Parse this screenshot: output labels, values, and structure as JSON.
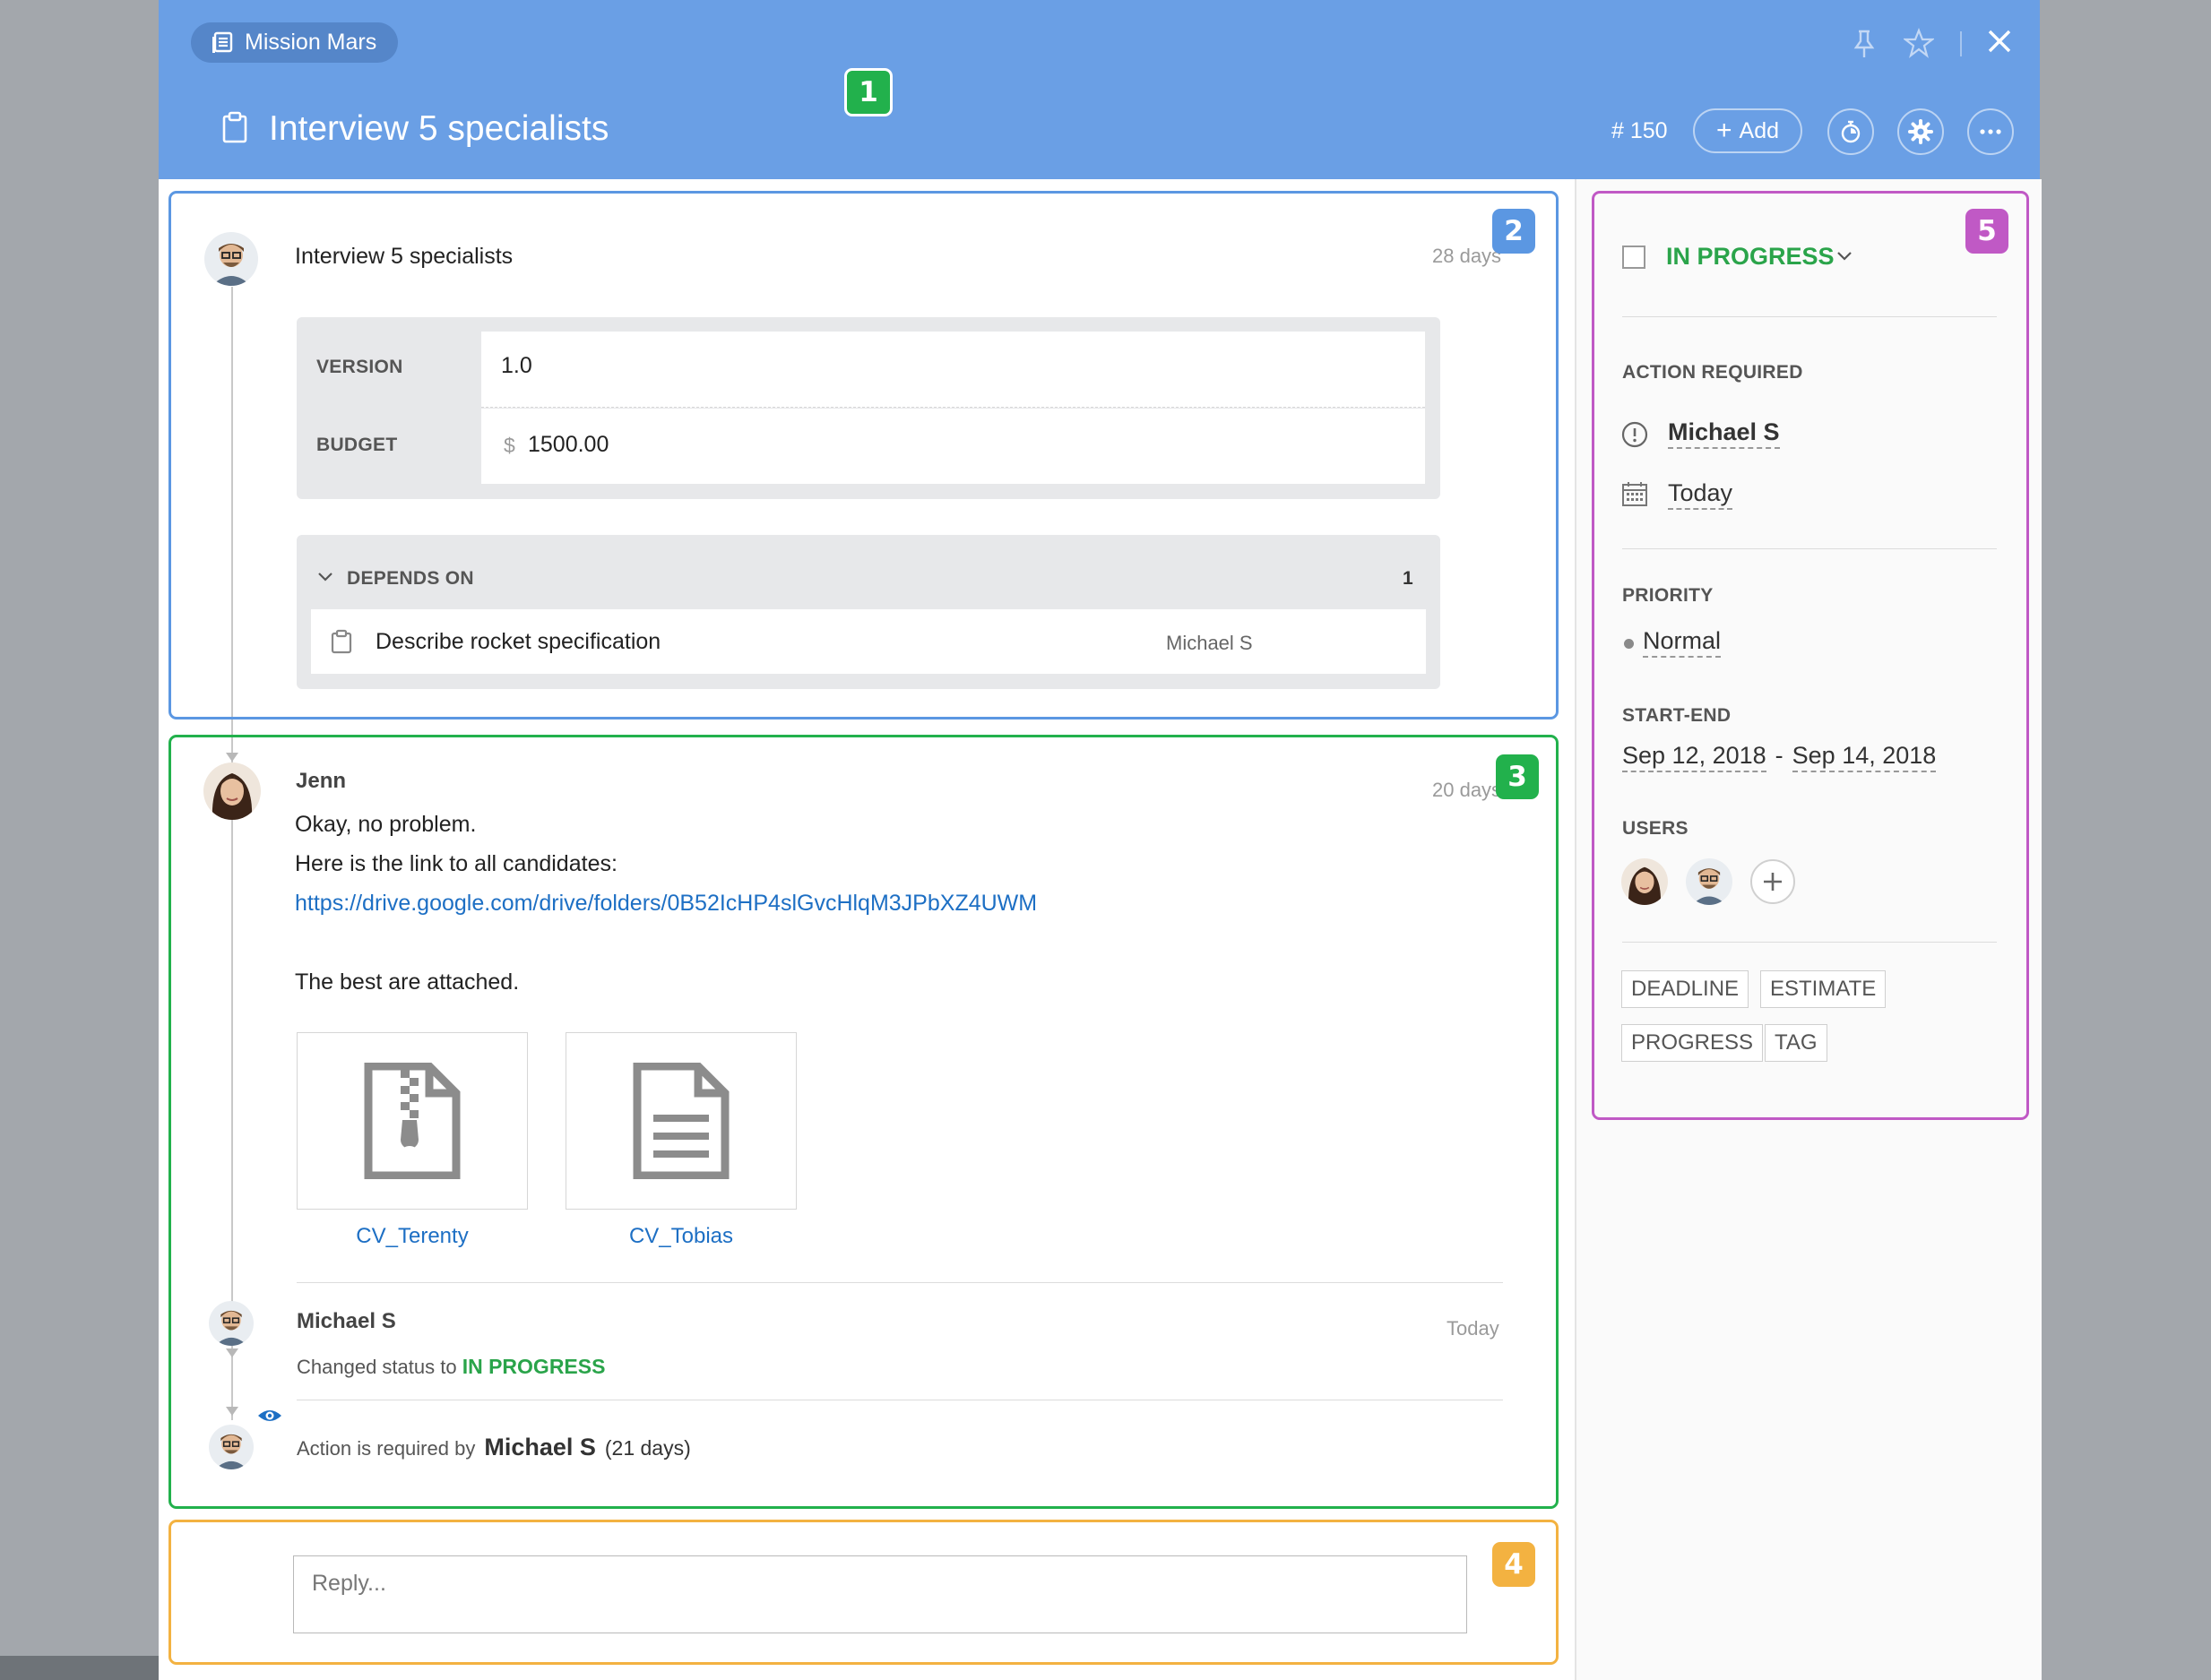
{
  "header": {
    "breadcrumb": "Mission Mars",
    "title": "Interview 5 specialists",
    "task_number": "# 150",
    "add_label": "Add"
  },
  "markers": {
    "m1": "1",
    "m2": "2",
    "m3": "3",
    "m4": "4",
    "m5": "5"
  },
  "task": {
    "title": "Interview 5 specialists",
    "age": "28 days",
    "fields": [
      {
        "label": "VERSION",
        "value": "1.0",
        "prefix": ""
      },
      {
        "label": "BUDGET",
        "value": "1500.00",
        "prefix": "$"
      }
    ],
    "depends": {
      "label": "DEPENDS ON",
      "count": "1",
      "items": [
        {
          "title": "Describe rocket specification",
          "assignee": "Michael S"
        }
      ]
    }
  },
  "comment": {
    "author": "Jenn",
    "age": "20 days",
    "line1": "Okay, no problem.",
    "line2": "Here is the link to all candidates:",
    "link": "https://drive.google.com/drive/folders/0B52IcHP4slGvcHlqM3JPbXZ4UWM",
    "line3": "The best are attached.",
    "attachments": [
      {
        "name": "CV_Terenty",
        "icon": "zip-file-icon"
      },
      {
        "name": "CV_Tobias",
        "icon": "document-file-icon"
      }
    ]
  },
  "activity": [
    {
      "author": "Michael S",
      "time": "Today",
      "text": "Changed status to",
      "status": "IN PROGRESS"
    }
  ],
  "action_required_note": {
    "prefix": "Action is required by",
    "user": "Michael S",
    "suffix": "(21 days)"
  },
  "reply": {
    "placeholder": "Reply..."
  },
  "sidebar": {
    "status": "IN PROGRESS",
    "action_required_label": "ACTION REQUIRED",
    "action_user": "Michael S",
    "action_date": "Today",
    "priority_label": "PRIORITY",
    "priority": "Normal",
    "start_end_label": "START-END",
    "start": "Sep 12, 2018",
    "end": "Sep 14, 2018",
    "date_separator": "-",
    "users_label": "USERS",
    "tags": [
      "DEADLINE",
      "ESTIMATE",
      "PROGRESS",
      "TAG"
    ]
  },
  "colors": {
    "header": "#6a9fe5",
    "status_green": "#2aa44a",
    "link": "#1d6fc4",
    "marker_blue": "#5b97e2",
    "marker_green": "#22b14c",
    "marker_orange": "#f3b241",
    "marker_purple": "#c059c5"
  }
}
